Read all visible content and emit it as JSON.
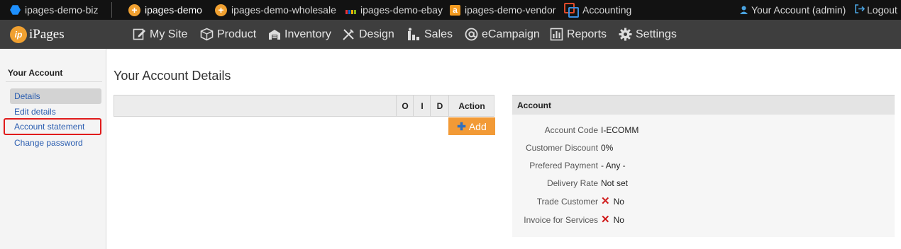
{
  "topbar": {
    "sites": [
      {
        "label": "ipages-demo-biz",
        "icon": "hexagon-icon"
      },
      {
        "label": "ipages-demo",
        "icon": "plus-icon"
      },
      {
        "label": "ipages-demo-wholesale",
        "icon": "plus-icon"
      },
      {
        "label": "ipages-demo-ebay",
        "icon": "ebay-icon"
      },
      {
        "label": "ipages-demo-vendor",
        "icon": "amazon-icon"
      },
      {
        "label": "Accounting",
        "icon": "accounting-icon"
      }
    ],
    "account_label": "Your Account (admin)",
    "logout_label": "Logout"
  },
  "logo": {
    "badge": "ip",
    "text": "iPages"
  },
  "nav": [
    {
      "label": "My Site",
      "icon": "edit-icon"
    },
    {
      "label": "Product",
      "icon": "box-icon"
    },
    {
      "label": "Inventory",
      "icon": "warehouse-icon"
    },
    {
      "label": "Design",
      "icon": "tools-icon"
    },
    {
      "label": "Sales",
      "icon": "sales-icon"
    },
    {
      "label": "eCampaign",
      "icon": "at-icon"
    },
    {
      "label": "Reports",
      "icon": "chart-icon"
    },
    {
      "label": "Settings",
      "icon": "gear-icon"
    }
  ],
  "sidebar": {
    "title": "Your Account",
    "items": [
      {
        "label": "Details"
      },
      {
        "label": "Edit details"
      },
      {
        "label": "Account statement"
      },
      {
        "label": "Change password"
      }
    ]
  },
  "main": {
    "title": "Your Account Details",
    "grid": {
      "columns": [
        "O",
        "I",
        "D",
        "Action"
      ]
    },
    "add_label": "Add"
  },
  "account": {
    "heading": "Account",
    "rows": [
      {
        "label": "Account Code",
        "value": "I-ECOMM"
      },
      {
        "label": "Customer Discount",
        "value": "0%"
      },
      {
        "label": "Prefered Payment",
        "value": "- Any -"
      },
      {
        "label": "Delivery Rate",
        "value": "Not set"
      },
      {
        "label": "Trade Customer",
        "value": "No"
      },
      {
        "label": "Invoice for Services",
        "value": "No"
      }
    ]
  },
  "colors": {
    "accent_orange": "#f29a36",
    "link_blue": "#2a5db0",
    "highlight_red": "#e01b1b"
  }
}
